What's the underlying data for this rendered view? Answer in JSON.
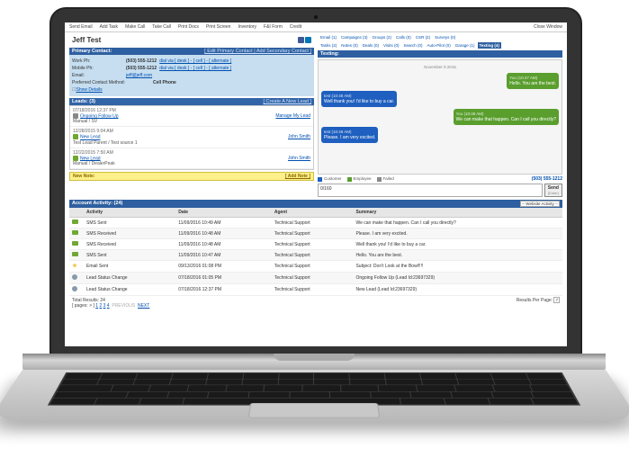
{
  "menu": {
    "items": [
      "Send Email",
      "Add Task",
      "Make Call",
      "Take Call",
      "Print Docs",
      "Print Screen",
      "Inventory",
      "F&I Form",
      "Credit"
    ],
    "close": "Close Window"
  },
  "contact": {
    "name": "Jeff Test",
    "panel_title": "Primary Contact:",
    "panel_links": "[ Edit Primary Contact | Add Secondary Contact ]",
    "work_label": "Work Ph:",
    "work_val": "(503) 555-1212",
    "work_links": "dial via [ desk ] - [ cell ] - [ alternate ]",
    "mobile_label": "Mobile Ph:",
    "mobile_val": "(503) 555-1212",
    "mobile_links": "dial via [ desk ] - [ cell ] - [ alternate ]",
    "email_label": "Email:",
    "email_val": "jeff@jeff.com",
    "pref_label": "Preferred Contact Method:",
    "pref_val": "Cell Phone",
    "show_details": "Show Details"
  },
  "leads": {
    "head": "Leads: (3)",
    "create": "[ Create A New Lead ]",
    "items": [
      {
        "date": "07/18/2016 12:37 PM",
        "title": "Ongoing Follow Up",
        "sub": "Manual / SV",
        "right": "Manage My Lead"
      },
      {
        "date": "12/28/2015 9:04 AM",
        "title": "New Lead",
        "sub": "Test Lead Parent / Test source 1",
        "right": "John Smith"
      },
      {
        "date": "12/22/2015 7:50 AM",
        "title": "New Lead",
        "sub": "Manual / DealerPeak",
        "right": "John Smith"
      }
    ]
  },
  "note": {
    "title": "New Note:",
    "add": "[ Add Note ]"
  },
  "tabs_top": [
    "Email (1)",
    "Campaigns (3)",
    "Groups (2)",
    "Calls (0)",
    "CSR (2)",
    "Surveys (0)"
  ],
  "tabs_bot": [
    "Tasks (2)",
    "Notes (0)",
    "Deals (0)",
    "Visits (0)",
    "Search (0)",
    "Auto-Pilot (0)",
    "Garage (1)",
    "Texting (4)"
  ],
  "texting": {
    "head": "Texting:",
    "date": "November 9 2016",
    "messages": [
      {
        "side": "green",
        "from": "You (10:47 AM)",
        "text": "Hello. You are the best."
      },
      {
        "side": "blue",
        "from": "test (10:48 AM)",
        "text": "Well thank you! I'd like to buy a car."
      },
      {
        "side": "green",
        "from": "You (10:48 AM)",
        "text": "We can make that happen. Can I call you directly?"
      },
      {
        "side": "blue",
        "from": "test (10:49 AM)",
        "text": "Please. I am very excited."
      }
    ],
    "legend": {
      "c": "Customer",
      "e": "Employee",
      "f": "Failed"
    },
    "phone": "(503) 555-1212",
    "input": "0/160",
    "send": "Send",
    "enter": "(Enter)"
  },
  "activity": {
    "head": "Account Activity: (24)",
    "webact": "-- Website Activity --",
    "cols": {
      "a": "Activity",
      "d": "Date",
      "g": "Agent",
      "s": "Summary"
    },
    "rows": [
      {
        "ico": "sms",
        "a": "SMS Sent",
        "d": "11/09/2016 10:49 AM",
        "g": "Technical Support",
        "s": "We can make that happen. Can I call you directly?"
      },
      {
        "ico": "sms",
        "a": "SMS Received",
        "d": "11/09/2016 10:48 AM",
        "g": "Technical Support",
        "s": "Please. I am very excited."
      },
      {
        "ico": "sms",
        "a": "SMS Received",
        "d": "11/09/2016 10:48 AM",
        "g": "Technical Support",
        "s": "Well thank you! I'd like to buy a car."
      },
      {
        "ico": "sms",
        "a": "SMS Sent",
        "d": "11/09/2016 10:47 AM",
        "g": "Technical Support",
        "s": "Hello. You are the best."
      },
      {
        "ico": "star",
        "a": "Email Sent",
        "d": "09/13/2016 01:08 PM",
        "g": "Technical Support",
        "s": "Subject: Don't Look at the Bowl!!!!"
      },
      {
        "ico": "circ",
        "a": "Lead Status Change",
        "d": "07/18/2016 01:05 PM",
        "g": "Technical Support",
        "s": "Ongoing Follow Up (Lead Id:23697329)"
      },
      {
        "ico": "circ",
        "a": "Lead Status Change",
        "d": "07/18/2016 12:37 PM",
        "g": "Technical Support",
        "s": "New Lead (Lead Id:23697329)"
      }
    ],
    "total": "Total Results: 24",
    "pages_label": "[ pages: > ]",
    "pages": [
      "1",
      "2",
      "3",
      "4"
    ],
    "prev": "PREVIOUS",
    "next": "NEXT",
    "rpp_label": "Results Per Page:",
    "rpp": "7"
  }
}
